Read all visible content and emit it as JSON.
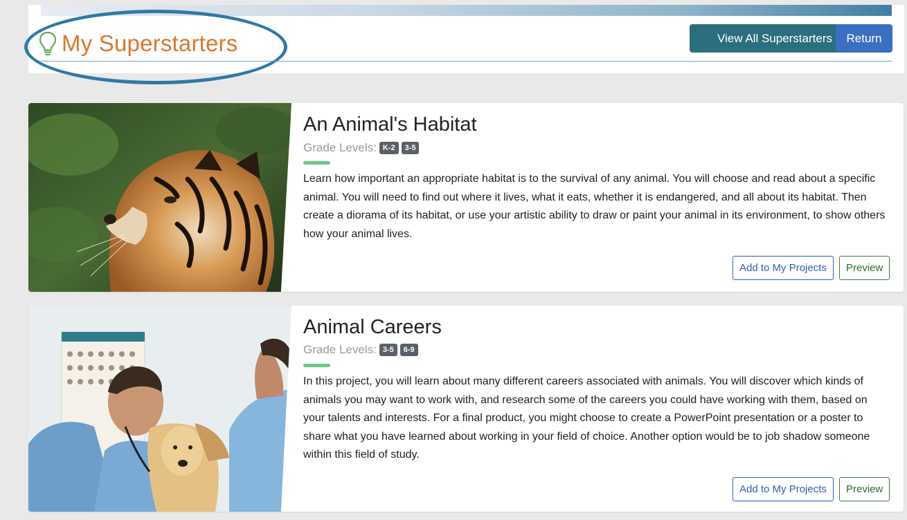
{
  "header": {
    "title": "My Superstarters",
    "title_icon": "lightbulb-icon",
    "view_all_label": "View All Superstarters",
    "return_label": "Return"
  },
  "colors": {
    "title": "#d9782c",
    "annotation_oval": "#2e7aa6",
    "view_all_button": "#2b6f7e",
    "return_button": "#3a6fc2",
    "grade_badge": "#5a6068",
    "accent_bar": "#6cc983"
  },
  "projects": [
    {
      "image": "tiger-photo",
      "title": "An Animal's Habitat",
      "grade_label": "Grade Levels:",
      "grades": [
        "K-2",
        "3-5"
      ],
      "description": "Learn how important an appropriate habitat is to the survival of any animal. You will choose and read about a specific animal. You will need to find out where it lives, what it eats, whether it is endangered, and all about its habitat. Then create a diorama of its habitat, or use your artistic ability to draw or paint your animal in its environment, to show others how your animal lives.",
      "add_label": "Add to My Projects",
      "preview_label": "Preview"
    },
    {
      "image": "veterinarian-with-dog-photo",
      "title": "Animal Careers",
      "grade_label": "Grade Levels:",
      "grades": [
        "3-5",
        "6-9"
      ],
      "description": "In this project, you will learn about many different careers associated with animals. You will discover which kinds of animals you may want to work with, and research some of the careers you could have working with them, based on your talents and interests. For a final product, you might choose to create a PowerPoint presentation or a poster to share what you have learned about working in your field of choice. Another option would be to job shadow someone within this field of study.",
      "add_label": "Add to My Projects",
      "preview_label": "Preview"
    }
  ]
}
